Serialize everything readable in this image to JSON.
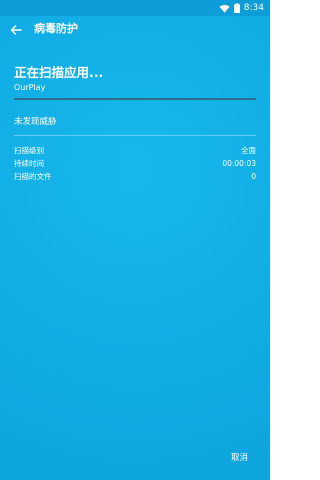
{
  "status_bar": {
    "time": "8:34"
  },
  "app_bar": {
    "title": "病毒防护"
  },
  "scan": {
    "title": "正在扫描应用...",
    "target": "OurPlay",
    "progress": 1.0,
    "threat_status": "未发现威胁"
  },
  "details": [
    {
      "label": "扫描级别",
      "value": "全面"
    },
    {
      "label": "持续时间",
      "value": "00:00:03"
    },
    {
      "label": "扫描的文件",
      "value": "0"
    }
  ],
  "actions": {
    "cancel_label": "取消"
  },
  "colors": {
    "background": "#12aee6",
    "status_bar": "#0d9ed9",
    "progress_fill": "#2c6f86",
    "text": "#ffffff"
  }
}
